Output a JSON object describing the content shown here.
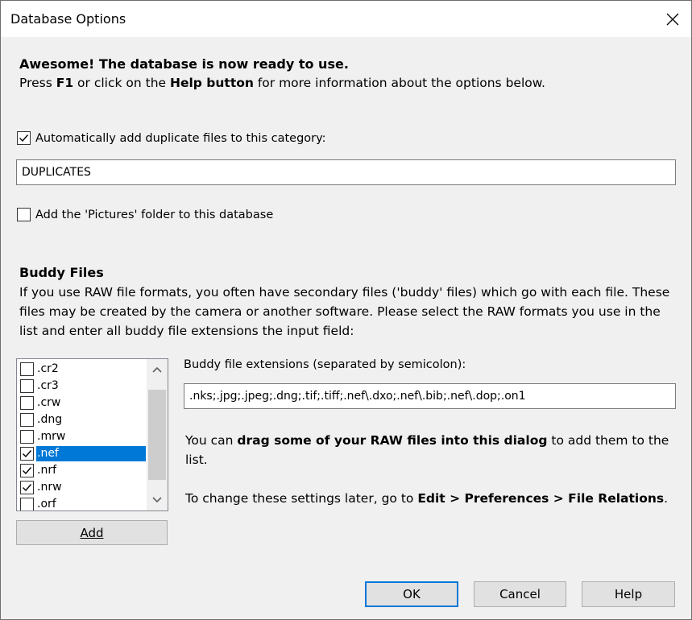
{
  "window": {
    "title": "Database Options"
  },
  "intro": {
    "heading": "Awesome! The database is now ready to use.",
    "line_pre": "Press ",
    "line_key": "F1",
    "line_mid": " or click on the ",
    "line_button": "Help button",
    "line_post": " for more information about the options below."
  },
  "duplicates": {
    "checkbox_label": "Automatically add duplicate files to this category:",
    "checked": true,
    "category_value": "DUPLICATES"
  },
  "pictures": {
    "checkbox_label": "Add the 'Pictures' folder to this database",
    "checked": false
  },
  "buddy": {
    "heading": "Buddy Files",
    "description": "If you use RAW file formats, you often have secondary files ('buddy' files) which go with each file. These files may be created by the camera or another software. Please select the RAW formats you use in the list and enter all buddy file extensions the input field:",
    "formats": [
      {
        "label": ".cr2",
        "checked": false,
        "selected": false
      },
      {
        "label": ".cr3",
        "checked": false,
        "selected": false
      },
      {
        "label": ".crw",
        "checked": false,
        "selected": false
      },
      {
        "label": ".dng",
        "checked": false,
        "selected": false
      },
      {
        "label": ".mrw",
        "checked": false,
        "selected": false
      },
      {
        "label": ".nef",
        "checked": true,
        "selected": true
      },
      {
        "label": ".nrf",
        "checked": true,
        "selected": false
      },
      {
        "label": ".nrw",
        "checked": true,
        "selected": false
      },
      {
        "label": ".orf",
        "checked": false,
        "selected": false
      }
    ],
    "add_button": "Add",
    "extensions_label": "Buddy file extensions (separated by semicolon):",
    "extensions_value": ".nks;.jpg;.jpeg;.dng;.tif;.tiff;.nef\\.dxo;.nef\\.bib;.nef\\.dop;.on1",
    "drag_pre": "You can ",
    "drag_bold": "drag some of your RAW files into this dialog",
    "drag_post": " to add them to the list.",
    "settings_pre": "To change these settings later, go to ",
    "settings_path": "Edit > Preferences > File Relations",
    "settings_post": "."
  },
  "buttons": {
    "ok": "OK",
    "cancel": "Cancel",
    "help": "Help"
  },
  "colors": {
    "selection": "#0078d7",
    "dialog_bg": "#f0f0f0"
  }
}
